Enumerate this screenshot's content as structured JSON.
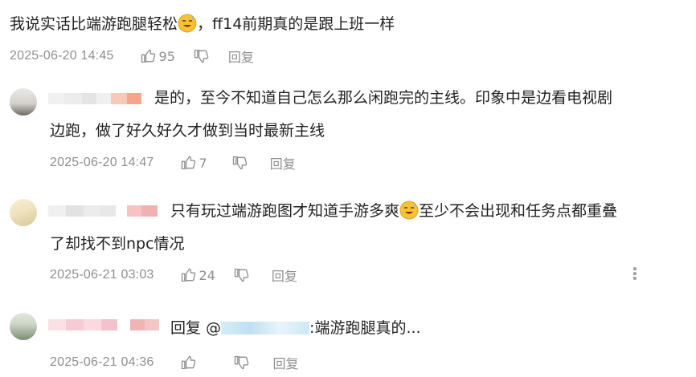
{
  "comments": [
    {
      "text_a": "我说实话比端游跑腿轻松",
      "text_b": "，ff14前期真的是跟上班一样",
      "emoji": "grinning-sweat-emoji",
      "time": "2025-06-20 14:45",
      "likes": "95",
      "reply_label": "回复"
    },
    {
      "line1": "是的，至今不知道自己怎么那么闲跑完的主线。印象中是边看电视剧",
      "line2": "边跑，做了好久好久才做到当时最新主线",
      "time": "2025-06-20 14:47",
      "likes": "7",
      "reply_label": "回复"
    },
    {
      "line1_a": "只有玩过端游跑图才知道手游多爽",
      "line1_b": "至少不会出现和任务点都重叠",
      "line2": "了却找不到npc情况",
      "emoji": "grinning-sweat-emoji",
      "time": "2025-06-21 03:03",
      "likes": "24",
      "reply_label": "回复",
      "more": "⋮"
    },
    {
      "reply_prefix": "回复 @",
      "reply_text": ":端游跑腿真的...",
      "time": "2025-06-21 04:36",
      "reply_label": "回复"
    }
  ],
  "colors": {
    "meta": "#8f8f8f",
    "text": "#222222",
    "mention": "#4a6fb5"
  }
}
